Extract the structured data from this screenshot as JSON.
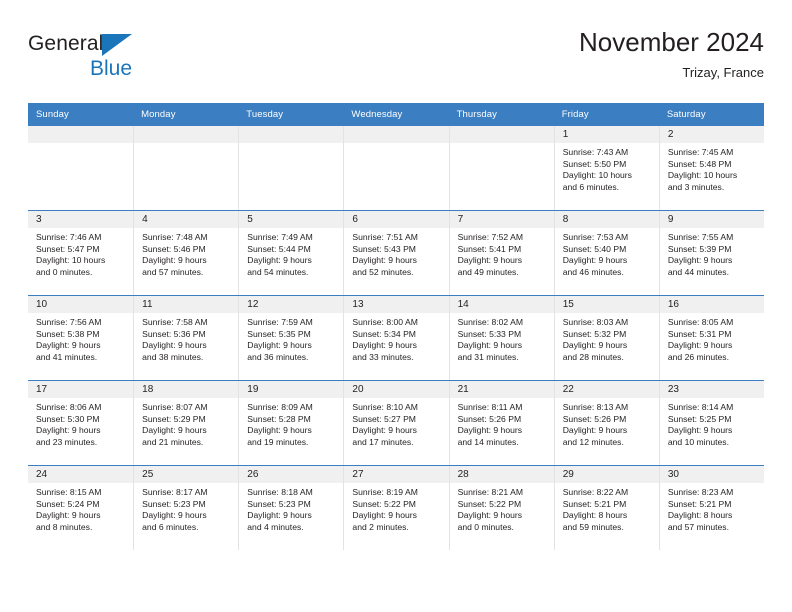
{
  "brand": {
    "word_general": "General",
    "word_blue": "Blue",
    "flag_icon": "blue-triangle-flag-icon",
    "accent_color": "#1b75bb"
  },
  "header": {
    "title": "November 2024",
    "subtitle": "Trizay, France"
  },
  "theme": {
    "header_blue": "#3b7ec1",
    "daynum_band": "#f0f0f0",
    "text": "#231f20",
    "cell_divider": "#e3e3e3"
  },
  "calendar": {
    "weekday_headers": [
      "Sunday",
      "Monday",
      "Tuesday",
      "Wednesday",
      "Thursday",
      "Friday",
      "Saturday"
    ],
    "weeks": [
      [
        {
          "day": "",
          "sunrise": "",
          "sunset": "",
          "daylight_line1": "",
          "daylight_line2": ""
        },
        {
          "day": "",
          "sunrise": "",
          "sunset": "",
          "daylight_line1": "",
          "daylight_line2": ""
        },
        {
          "day": "",
          "sunrise": "",
          "sunset": "",
          "daylight_line1": "",
          "daylight_line2": ""
        },
        {
          "day": "",
          "sunrise": "",
          "sunset": "",
          "daylight_line1": "",
          "daylight_line2": ""
        },
        {
          "day": "",
          "sunrise": "",
          "sunset": "",
          "daylight_line1": "",
          "daylight_line2": ""
        },
        {
          "day": "1",
          "sunrise": "Sunrise: 7:43 AM",
          "sunset": "Sunset: 5:50 PM",
          "daylight_line1": "Daylight: 10 hours",
          "daylight_line2": "and 6 minutes."
        },
        {
          "day": "2",
          "sunrise": "Sunrise: 7:45 AM",
          "sunset": "Sunset: 5:48 PM",
          "daylight_line1": "Daylight: 10 hours",
          "daylight_line2": "and 3 minutes."
        }
      ],
      [
        {
          "day": "3",
          "sunrise": "Sunrise: 7:46 AM",
          "sunset": "Sunset: 5:47 PM",
          "daylight_line1": "Daylight: 10 hours",
          "daylight_line2": "and 0 minutes."
        },
        {
          "day": "4",
          "sunrise": "Sunrise: 7:48 AM",
          "sunset": "Sunset: 5:46 PM",
          "daylight_line1": "Daylight: 9 hours",
          "daylight_line2": "and 57 minutes."
        },
        {
          "day": "5",
          "sunrise": "Sunrise: 7:49 AM",
          "sunset": "Sunset: 5:44 PM",
          "daylight_line1": "Daylight: 9 hours",
          "daylight_line2": "and 54 minutes."
        },
        {
          "day": "6",
          "sunrise": "Sunrise: 7:51 AM",
          "sunset": "Sunset: 5:43 PM",
          "daylight_line1": "Daylight: 9 hours",
          "daylight_line2": "and 52 minutes."
        },
        {
          "day": "7",
          "sunrise": "Sunrise: 7:52 AM",
          "sunset": "Sunset: 5:41 PM",
          "daylight_line1": "Daylight: 9 hours",
          "daylight_line2": "and 49 minutes."
        },
        {
          "day": "8",
          "sunrise": "Sunrise: 7:53 AM",
          "sunset": "Sunset: 5:40 PM",
          "daylight_line1": "Daylight: 9 hours",
          "daylight_line2": "and 46 minutes."
        },
        {
          "day": "9",
          "sunrise": "Sunrise: 7:55 AM",
          "sunset": "Sunset: 5:39 PM",
          "daylight_line1": "Daylight: 9 hours",
          "daylight_line2": "and 44 minutes."
        }
      ],
      [
        {
          "day": "10",
          "sunrise": "Sunrise: 7:56 AM",
          "sunset": "Sunset: 5:38 PM",
          "daylight_line1": "Daylight: 9 hours",
          "daylight_line2": "and 41 minutes."
        },
        {
          "day": "11",
          "sunrise": "Sunrise: 7:58 AM",
          "sunset": "Sunset: 5:36 PM",
          "daylight_line1": "Daylight: 9 hours",
          "daylight_line2": "and 38 minutes."
        },
        {
          "day": "12",
          "sunrise": "Sunrise: 7:59 AM",
          "sunset": "Sunset: 5:35 PM",
          "daylight_line1": "Daylight: 9 hours",
          "daylight_line2": "and 36 minutes."
        },
        {
          "day": "13",
          "sunrise": "Sunrise: 8:00 AM",
          "sunset": "Sunset: 5:34 PM",
          "daylight_line1": "Daylight: 9 hours",
          "daylight_line2": "and 33 minutes."
        },
        {
          "day": "14",
          "sunrise": "Sunrise: 8:02 AM",
          "sunset": "Sunset: 5:33 PM",
          "daylight_line1": "Daylight: 9 hours",
          "daylight_line2": "and 31 minutes."
        },
        {
          "day": "15",
          "sunrise": "Sunrise: 8:03 AM",
          "sunset": "Sunset: 5:32 PM",
          "daylight_line1": "Daylight: 9 hours",
          "daylight_line2": "and 28 minutes."
        },
        {
          "day": "16",
          "sunrise": "Sunrise: 8:05 AM",
          "sunset": "Sunset: 5:31 PM",
          "daylight_line1": "Daylight: 9 hours",
          "daylight_line2": "and 26 minutes."
        }
      ],
      [
        {
          "day": "17",
          "sunrise": "Sunrise: 8:06 AM",
          "sunset": "Sunset: 5:30 PM",
          "daylight_line1": "Daylight: 9 hours",
          "daylight_line2": "and 23 minutes."
        },
        {
          "day": "18",
          "sunrise": "Sunrise: 8:07 AM",
          "sunset": "Sunset: 5:29 PM",
          "daylight_line1": "Daylight: 9 hours",
          "daylight_line2": "and 21 minutes."
        },
        {
          "day": "19",
          "sunrise": "Sunrise: 8:09 AM",
          "sunset": "Sunset: 5:28 PM",
          "daylight_line1": "Daylight: 9 hours",
          "daylight_line2": "and 19 minutes."
        },
        {
          "day": "20",
          "sunrise": "Sunrise: 8:10 AM",
          "sunset": "Sunset: 5:27 PM",
          "daylight_line1": "Daylight: 9 hours",
          "daylight_line2": "and 17 minutes."
        },
        {
          "day": "21",
          "sunrise": "Sunrise: 8:11 AM",
          "sunset": "Sunset: 5:26 PM",
          "daylight_line1": "Daylight: 9 hours",
          "daylight_line2": "and 14 minutes."
        },
        {
          "day": "22",
          "sunrise": "Sunrise: 8:13 AM",
          "sunset": "Sunset: 5:26 PM",
          "daylight_line1": "Daylight: 9 hours",
          "daylight_line2": "and 12 minutes."
        },
        {
          "day": "23",
          "sunrise": "Sunrise: 8:14 AM",
          "sunset": "Sunset: 5:25 PM",
          "daylight_line1": "Daylight: 9 hours",
          "daylight_line2": "and 10 minutes."
        }
      ],
      [
        {
          "day": "24",
          "sunrise": "Sunrise: 8:15 AM",
          "sunset": "Sunset: 5:24 PM",
          "daylight_line1": "Daylight: 9 hours",
          "daylight_line2": "and 8 minutes."
        },
        {
          "day": "25",
          "sunrise": "Sunrise: 8:17 AM",
          "sunset": "Sunset: 5:23 PM",
          "daylight_line1": "Daylight: 9 hours",
          "daylight_line2": "and 6 minutes."
        },
        {
          "day": "26",
          "sunrise": "Sunrise: 8:18 AM",
          "sunset": "Sunset: 5:23 PM",
          "daylight_line1": "Daylight: 9 hours",
          "daylight_line2": "and 4 minutes."
        },
        {
          "day": "27",
          "sunrise": "Sunrise: 8:19 AM",
          "sunset": "Sunset: 5:22 PM",
          "daylight_line1": "Daylight: 9 hours",
          "daylight_line2": "and 2 minutes."
        },
        {
          "day": "28",
          "sunrise": "Sunrise: 8:21 AM",
          "sunset": "Sunset: 5:22 PM",
          "daylight_line1": "Daylight: 9 hours",
          "daylight_line2": "and 0 minutes."
        },
        {
          "day": "29",
          "sunrise": "Sunrise: 8:22 AM",
          "sunset": "Sunset: 5:21 PM",
          "daylight_line1": "Daylight: 8 hours",
          "daylight_line2": "and 59 minutes."
        },
        {
          "day": "30",
          "sunrise": "Sunrise: 8:23 AM",
          "sunset": "Sunset: 5:21 PM",
          "daylight_line1": "Daylight: 8 hours",
          "daylight_line2": "and 57 minutes."
        }
      ]
    ]
  }
}
